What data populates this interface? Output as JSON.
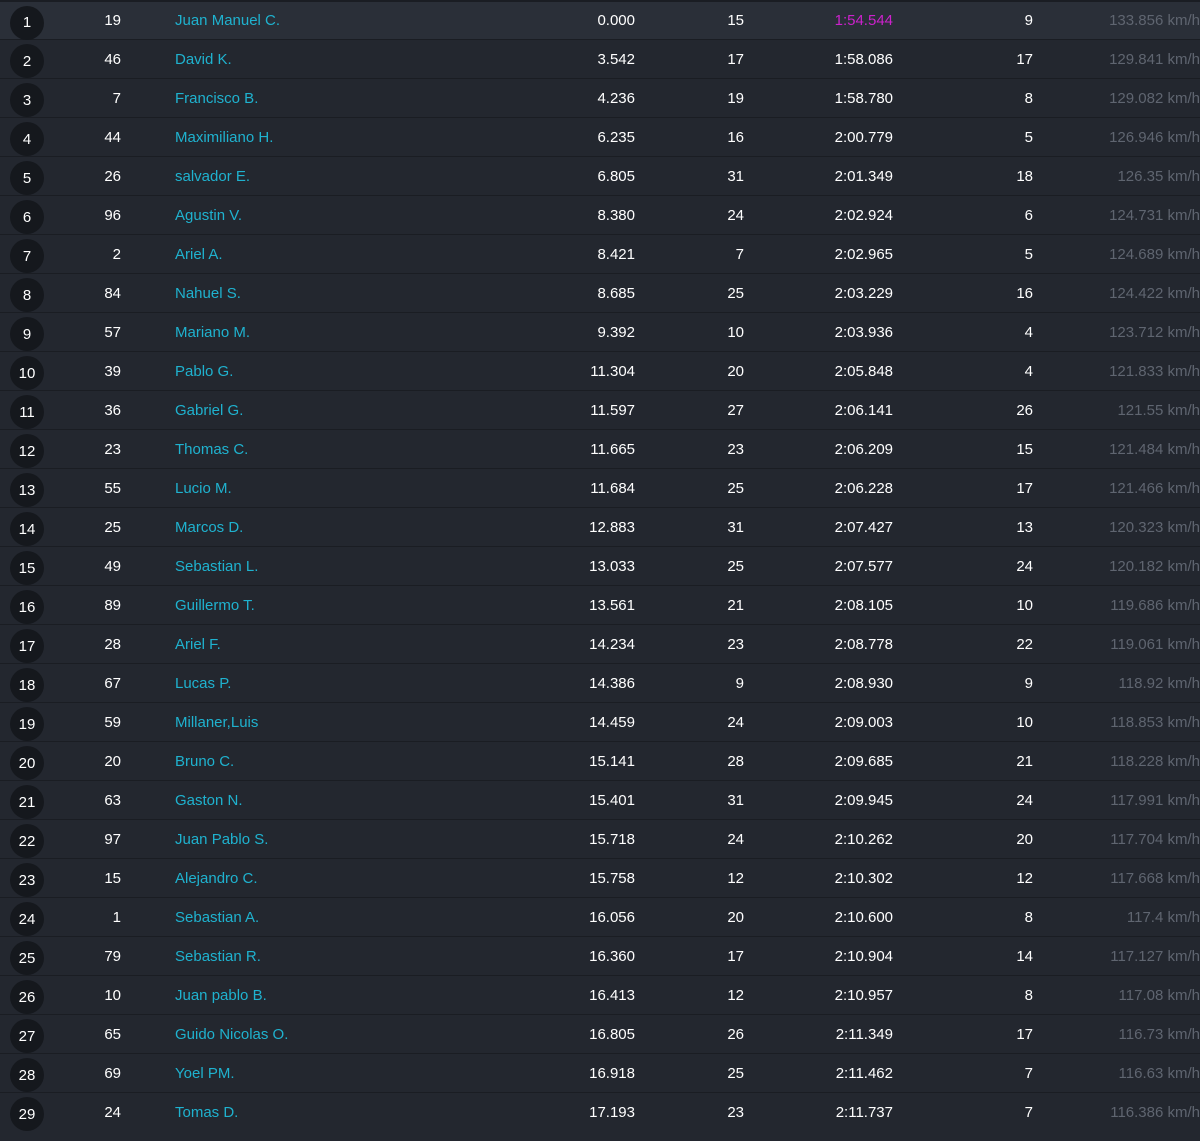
{
  "results": [
    {
      "pos": "1",
      "number": "19",
      "driver": "Juan Manuel C.",
      "gap": "0.000",
      "laps": "15",
      "best_time": "1:54.544",
      "best_lap_no": "9",
      "speed": "133.856 km/h",
      "fastest": true
    },
    {
      "pos": "2",
      "number": "46",
      "driver": "David K.",
      "gap": "3.542",
      "laps": "17",
      "best_time": "1:58.086",
      "best_lap_no": "17",
      "speed": "129.841 km/h"
    },
    {
      "pos": "3",
      "number": "7",
      "driver": "Francisco B.",
      "gap": "4.236",
      "laps": "19",
      "best_time": "1:58.780",
      "best_lap_no": "8",
      "speed": "129.082 km/h"
    },
    {
      "pos": "4",
      "number": "44",
      "driver": "Maximiliano H.",
      "gap": "6.235",
      "laps": "16",
      "best_time": "2:00.779",
      "best_lap_no": "5",
      "speed": "126.946 km/h"
    },
    {
      "pos": "5",
      "number": "26",
      "driver": "salvador E.",
      "gap": "6.805",
      "laps": "31",
      "best_time": "2:01.349",
      "best_lap_no": "18",
      "speed": "126.35 km/h"
    },
    {
      "pos": "6",
      "number": "96",
      "driver": "Agustin V.",
      "gap": "8.380",
      "laps": "24",
      "best_time": "2:02.924",
      "best_lap_no": "6",
      "speed": "124.731 km/h"
    },
    {
      "pos": "7",
      "number": "2",
      "driver": "Ariel A.",
      "gap": "8.421",
      "laps": "7",
      "best_time": "2:02.965",
      "best_lap_no": "5",
      "speed": "124.689 km/h"
    },
    {
      "pos": "8",
      "number": "84",
      "driver": "Nahuel S.",
      "gap": "8.685",
      "laps": "25",
      "best_time": "2:03.229",
      "best_lap_no": "16",
      "speed": "124.422 km/h"
    },
    {
      "pos": "9",
      "number": "57",
      "driver": "Mariano M.",
      "gap": "9.392",
      "laps": "10",
      "best_time": "2:03.936",
      "best_lap_no": "4",
      "speed": "123.712 km/h"
    },
    {
      "pos": "10",
      "number": "39",
      "driver": "Pablo G.",
      "gap": "11.304",
      "laps": "20",
      "best_time": "2:05.848",
      "best_lap_no": "4",
      "speed": "121.833 km/h"
    },
    {
      "pos": "11",
      "number": "36",
      "driver": "Gabriel G.",
      "gap": "11.597",
      "laps": "27",
      "best_time": "2:06.141",
      "best_lap_no": "26",
      "speed": "121.55 km/h"
    },
    {
      "pos": "12",
      "number": "23",
      "driver": "Thomas C.",
      "gap": "11.665",
      "laps": "23",
      "best_time": "2:06.209",
      "best_lap_no": "15",
      "speed": "121.484 km/h"
    },
    {
      "pos": "13",
      "number": "55",
      "driver": "Lucio M.",
      "gap": "11.684",
      "laps": "25",
      "best_time": "2:06.228",
      "best_lap_no": "17",
      "speed": "121.466 km/h"
    },
    {
      "pos": "14",
      "number": "25",
      "driver": "Marcos D.",
      "gap": "12.883",
      "laps": "31",
      "best_time": "2:07.427",
      "best_lap_no": "13",
      "speed": "120.323 km/h"
    },
    {
      "pos": "15",
      "number": "49",
      "driver": "Sebastian L.",
      "gap": "13.033",
      "laps": "25",
      "best_time": "2:07.577",
      "best_lap_no": "24",
      "speed": "120.182 km/h"
    },
    {
      "pos": "16",
      "number": "89",
      "driver": "Guillermo T.",
      "gap": "13.561",
      "laps": "21",
      "best_time": "2:08.105",
      "best_lap_no": "10",
      "speed": "119.686 km/h"
    },
    {
      "pos": "17",
      "number": "28",
      "driver": "Ariel F.",
      "gap": "14.234",
      "laps": "23",
      "best_time": "2:08.778",
      "best_lap_no": "22",
      "speed": "119.061 km/h"
    },
    {
      "pos": "18",
      "number": "67",
      "driver": "Lucas P.",
      "gap": "14.386",
      "laps": "9",
      "best_time": "2:08.930",
      "best_lap_no": "9",
      "speed": "118.92 km/h"
    },
    {
      "pos": "19",
      "number": "59",
      "driver": "Millaner,Luis",
      "gap": "14.459",
      "laps": "24",
      "best_time": "2:09.003",
      "best_lap_no": "10",
      "speed": "118.853 km/h"
    },
    {
      "pos": "20",
      "number": "20",
      "driver": "Bruno C.",
      "gap": "15.141",
      "laps": "28",
      "best_time": "2:09.685",
      "best_lap_no": "21",
      "speed": "118.228 km/h"
    },
    {
      "pos": "21",
      "number": "63",
      "driver": "Gaston N.",
      "gap": "15.401",
      "laps": "31",
      "best_time": "2:09.945",
      "best_lap_no": "24",
      "speed": "117.991 km/h"
    },
    {
      "pos": "22",
      "number": "97",
      "driver": "Juan Pablo S.",
      "gap": "15.718",
      "laps": "24",
      "best_time": "2:10.262",
      "best_lap_no": "20",
      "speed": "117.704 km/h"
    },
    {
      "pos": "23",
      "number": "15",
      "driver": "Alejandro C.",
      "gap": "15.758",
      "laps": "12",
      "best_time": "2:10.302",
      "best_lap_no": "12",
      "speed": "117.668 km/h"
    },
    {
      "pos": "24",
      "number": "1",
      "driver": "Sebastian A.",
      "gap": "16.056",
      "laps": "20",
      "best_time": "2:10.600",
      "best_lap_no": "8",
      "speed": "117.4 km/h"
    },
    {
      "pos": "25",
      "number": "79",
      "driver": "Sebastian R.",
      "gap": "16.360",
      "laps": "17",
      "best_time": "2:10.904",
      "best_lap_no": "14",
      "speed": "117.127 km/h"
    },
    {
      "pos": "26",
      "number": "10",
      "driver": "Juan pablo B.",
      "gap": "16.413",
      "laps": "12",
      "best_time": "2:10.957",
      "best_lap_no": "8",
      "speed": "117.08 km/h"
    },
    {
      "pos": "27",
      "number": "65",
      "driver": "Guido Nicolas O.",
      "gap": "16.805",
      "laps": "26",
      "best_time": "2:11.349",
      "best_lap_no": "17",
      "speed": "116.73 km/h"
    },
    {
      "pos": "28",
      "number": "69",
      "driver": "Yoel PM.",
      "gap": "16.918",
      "laps": "25",
      "best_time": "2:11.462",
      "best_lap_no": "7",
      "speed": "116.63 km/h"
    },
    {
      "pos": "29",
      "number": "24",
      "driver": "Tomas D.",
      "gap": "17.193",
      "laps": "23",
      "best_time": "2:11.737",
      "best_lap_no": "7",
      "speed": "116.386 km/h"
    }
  ],
  "colors": {
    "background": "#23272f",
    "driver_link": "#1fb2cf",
    "fastest_lap": "#cc22cc",
    "speed_text": "#5f6570",
    "position_badge": "#15181d"
  }
}
